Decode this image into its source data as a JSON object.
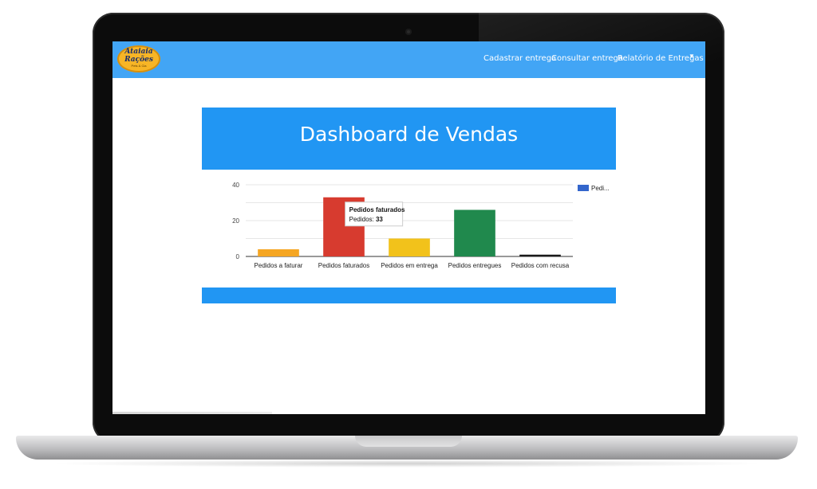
{
  "brand": {
    "logo_line1": "Ataiaia",
    "logo_line2": "Rações",
    "logo_sub": "Pets & Cia"
  },
  "nav": {
    "links": [
      {
        "label": "Cadastrar entrega"
      },
      {
        "label": "Consultar entrega"
      },
      {
        "label": "Relatório de Entregas"
      }
    ],
    "caret": "▼"
  },
  "dashboard": {
    "title": "Dashboard de Vendas"
  },
  "chart_data": {
    "type": "bar",
    "categories": [
      "Pedidos a faturar",
      "Pedidos faturados",
      "Pedidos em entrega",
      "Pedidos entregues",
      "Pedidos com recusa"
    ],
    "series": [
      {
        "name": "Pedi...",
        "values": [
          4,
          33,
          10,
          26,
          1
        ]
      }
    ],
    "colors": [
      "#f5a623",
      "#d73b2f",
      "#f2c21b",
      "#20894d",
      "#1a1a1a"
    ],
    "legend_color": "#3366cc",
    "yticks": [
      0,
      20,
      40
    ],
    "ylim": [
      0,
      40
    ],
    "grid": true,
    "legend_position": "right",
    "tooltip": {
      "title": "Pedidos faturados",
      "label": "Pedidos:",
      "value": "33",
      "category_index": 1
    }
  }
}
